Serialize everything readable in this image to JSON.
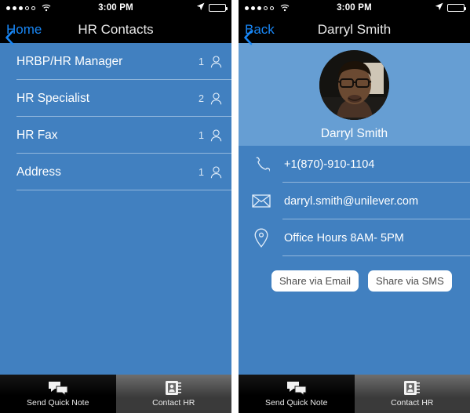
{
  "colors": {
    "blue_primary": "#4180c0",
    "blue_header": "#669ed3",
    "separator": "#92b7dc",
    "nav_bg": "#000000",
    "nav_tint": "#1886f5",
    "tab_active_bg": "#4f4f4f",
    "tab_inactive_bg": "#000000"
  },
  "left_screen": {
    "status_bar": {
      "time": "3:00 PM",
      "signal_dots_filled": 3,
      "signal_dots_total": 5,
      "wifi_icon": "wifi-icon",
      "location_icon": "location-arrow-icon",
      "battery_icon": "battery-icon",
      "battery_level_pct": 60
    },
    "nav": {
      "back_label": "Home",
      "back_icon": "chevron-left-icon",
      "title": "HR Contacts"
    },
    "list": [
      {
        "label": "HRBP/HR Manager",
        "count": "1",
        "icon": "person-icon"
      },
      {
        "label": "HR Specialist",
        "count": "2",
        "icon": "person-icon"
      },
      {
        "label": "HR Fax",
        "count": "1",
        "icon": "person-icon"
      },
      {
        "label": "Address",
        "count": "1",
        "icon": "person-icon"
      }
    ],
    "tabs": [
      {
        "label": "Send Quick Note",
        "icon": "chat-bubbles-icon",
        "selected": false
      },
      {
        "label": "Contact HR",
        "icon": "contacts-book-icon",
        "selected": true
      }
    ]
  },
  "right_screen": {
    "status_bar": {
      "time": "3:00 PM",
      "signal_dots_filled": 3,
      "signal_dots_total": 5,
      "wifi_icon": "wifi-icon",
      "location_icon": "location-arrow-icon",
      "battery_icon": "battery-icon",
      "battery_level_pct": 60
    },
    "nav": {
      "back_label": "Back",
      "back_icon": "chevron-left-icon",
      "title": "Darryl Smith"
    },
    "profile": {
      "avatar_icon": "avatar-photo",
      "name": "Darryl Smith"
    },
    "details": [
      {
        "icon": "phone-icon",
        "value": "+1(870)-910-1104"
      },
      {
        "icon": "envelope-icon",
        "value": "darryl.smith@unilever.com"
      },
      {
        "icon": "map-pin-icon",
        "value": "Office Hours 8AM- 5PM"
      }
    ],
    "share_buttons": [
      {
        "label": "Share via Email"
      },
      {
        "label": "Share via SMS"
      }
    ],
    "tabs": [
      {
        "label": "Send Quick Note",
        "icon": "chat-bubbles-icon",
        "selected": false
      },
      {
        "label": "Contact HR",
        "icon": "contacts-book-icon",
        "selected": true
      }
    ]
  }
}
